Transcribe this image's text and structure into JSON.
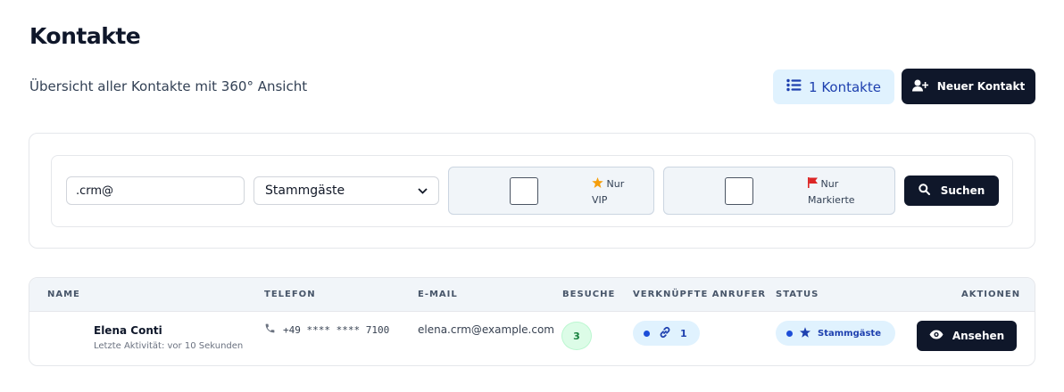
{
  "header": {
    "title": "Kontakte",
    "subtitle": "Übersicht aller Kontakte mit 360° Ansicht",
    "count_label": "1 Kontakte",
    "new_contact_label": "Neuer Kontakt"
  },
  "filters": {
    "search_value": ".crm@",
    "group_select": "Stammgäste",
    "vip_line1": "Nur",
    "vip_line2": "VIP",
    "marked_line1": "Nur",
    "marked_line2": "Markierte",
    "search_button": "Suchen"
  },
  "table": {
    "headers": {
      "name": "NAME",
      "phone": "TELEFON",
      "email": "E-MAIL",
      "visits": "BESUCHE",
      "linked": "VERKNÜPFTE ANRUFER",
      "status": "STATUS",
      "actions": "AKTIONEN"
    },
    "rows": [
      {
        "name": "Elena Conti",
        "activity": "Letzte Aktivität: vor 10 Sekunden",
        "phone": "+49 **** **** 7100",
        "email": "elena.crm@example.com",
        "visits": "3",
        "linked": "1",
        "status": "Stammgäste",
        "action": "Ansehen"
      }
    ]
  },
  "colors": {
    "primary": "#0f172a",
    "badge_bg": "#e0f2fe",
    "badge_text": "#1e40af",
    "visits_bg": "#dcfce7",
    "star": "#f59e0b",
    "flag": "#dc2626"
  },
  "icons": [
    "list-icon",
    "user-plus-icon",
    "star-icon",
    "flag-icon",
    "search-icon",
    "phone-icon",
    "link-icon",
    "eye-icon",
    "chevron-down-icon"
  ]
}
